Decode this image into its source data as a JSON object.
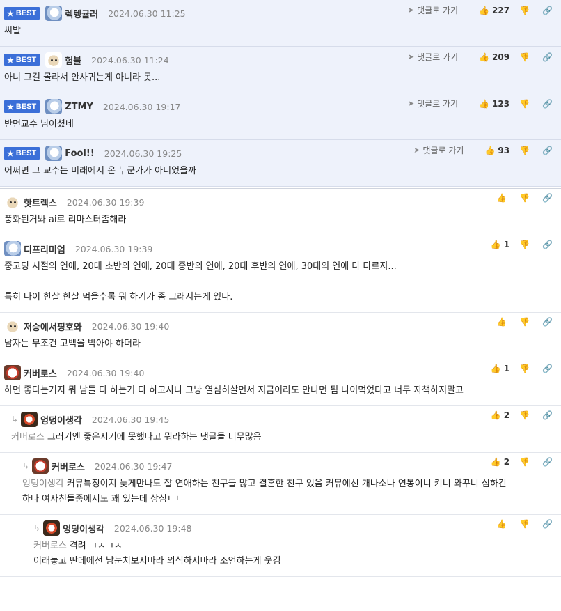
{
  "goto_label": "댓글로 가기",
  "best_label": "BEST",
  "best_comments": [
    {
      "nick": "렉텡귤러",
      "date": "2024.06.30 11:25",
      "likes": "227",
      "text": "씨발",
      "avatar": "blue"
    },
    {
      "nick": "험블",
      "date": "2024.06.30 11:24",
      "likes": "209",
      "text": "아니 그걸 몰라서 안사귀는게 아니라 못...",
      "avatar": "dog"
    },
    {
      "nick": "ZTMY",
      "date": "2024.06.30 19:17",
      "likes": "123",
      "text": "반면교수 님이셨네",
      "avatar": "blue"
    },
    {
      "nick": "Fool!!",
      "date": "2024.06.30 19:25",
      "likes": "93",
      "text": "어쩌면 그 교수는 미래에서 온 누군가가 아니었을까",
      "avatar": "blue"
    }
  ],
  "comments": [
    {
      "nick": "핫트렉스",
      "date": "2024.06.30 19:39",
      "likes": "",
      "lines": [
        "풍화된거봐 ai로 리마스터좀해라"
      ],
      "avatar": "dog",
      "level": 0
    },
    {
      "nick": "디프리미엄",
      "date": "2024.06.30 19:39",
      "likes": "1",
      "lines": [
        "중고딩 시절의 연애, 20대 초반의 연애, 20대 중반의 연애, 20대 후반의 연애, 30대의 연애 다 다르지...",
        "",
        "특히 나이 한살 한살 먹을수록 뭐 하기가 좀 그래지는게 있다."
      ],
      "avatar": "blue",
      "level": 0
    },
    {
      "nick": "저승에서핑호와",
      "date": "2024.06.30 19:40",
      "likes": "",
      "lines": [
        "남자는 무조건 고백을 박아야 하더라"
      ],
      "avatar": "dog",
      "level": 0
    },
    {
      "nick": "커버로스",
      "date": "2024.06.30 19:40",
      "likes": "1",
      "lines": [
        "하면 좋다는거지 뭐 남들 다 하는거 다 하고사나 그냥 열심히살면서 지금이라도 만나면 됨 나이먹었다고 너무 자책하지말고"
      ],
      "avatar": "ghost",
      "level": 0
    },
    {
      "nick": "엉덩이생각",
      "date": "2024.06.30 19:45",
      "likes": "2",
      "mention": "커버로스",
      "lines": [
        "그러기엔 좋은시기에 못했다고 뭐라하는 댓글들 너무많음"
      ],
      "avatar": "fire",
      "level": 1
    },
    {
      "nick": "커버로스",
      "date": "2024.06.30 19:47",
      "likes": "2",
      "mention": "엉덩이생각",
      "lines": [
        "커뮤특징이지 늦게만나도 잘 연애하는 친구들 많고 결혼한 친구 있음 커뮤에선 개나소나 연봉이니 키니 와꾸니 심하긴",
        "하다 여사친들중에서도 꽤 있는데 상심ㄴㄴ"
      ],
      "avatar": "ghost",
      "level": 2
    },
    {
      "nick": "엉덩이생각",
      "date": "2024.06.30 19:48",
      "likes": "",
      "mention": "커버로스",
      "lines": [
        "격려 ㄱㅅㄱㅅ",
        "이래놓고 딴데에선 남눈치보지마라 의식하지마라 조언하는게 웃김"
      ],
      "avatar": "fire",
      "level": 3
    }
  ]
}
